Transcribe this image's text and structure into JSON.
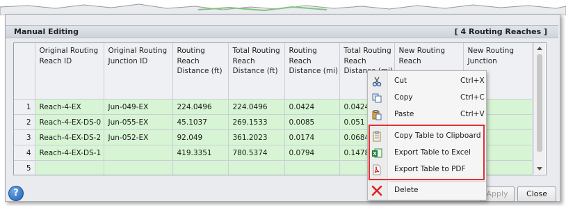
{
  "panel": {
    "title": "Manual Editing",
    "count_label": "[ 4 Routing Reaches ]"
  },
  "table": {
    "columns": [
      {
        "label": "Original Routing Reach ID"
      },
      {
        "label": "Original Routing Junction ID"
      },
      {
        "label": "Routing Reach Distance (ft)"
      },
      {
        "label": "Total Routing Reach Distance (ft)"
      },
      {
        "label": "Routing Reach Distance (mi)"
      },
      {
        "label": "Total Routing Reach Distance (mi)"
      },
      {
        "label": "New Routing Reach"
      },
      {
        "label": "New Routing Junction"
      }
    ],
    "rows": [
      {
        "n": "1",
        "c1": "Reach-4-EX",
        "c2": "Jun-049-EX",
        "c3": "224.0496",
        "c4": "224.0496",
        "c5": "0.0424",
        "c6": "0.0424"
      },
      {
        "n": "2",
        "c1": "Reach-4-EX-DS-0",
        "c2": "Jun-055-EX",
        "c3": "45.1037",
        "c4": "269.1533",
        "c5": "0.0085",
        "c6": "0.051"
      },
      {
        "n": "3",
        "c1": "Reach-4-EX-DS-2",
        "c2": "Jun-052-EX",
        "c3": "92.049",
        "c4": "361.2023",
        "c5": "0.0174",
        "c6": "0.0684"
      },
      {
        "n": "4",
        "c1": "Reach-4-EX-DS-1",
        "c2": "",
        "c3": "419.3351",
        "c4": "780.5374",
        "c5": "0.0794",
        "c6": "0.1478"
      },
      {
        "n": "5",
        "c1": "",
        "c2": "",
        "c3": "",
        "c4": "",
        "c5": "",
        "c6": ""
      }
    ]
  },
  "context_menu": {
    "cut": {
      "label": "Cut",
      "shortcut": "Ctrl+X"
    },
    "copy": {
      "label": "Copy",
      "shortcut": "Ctrl+C"
    },
    "paste": {
      "label": "Paste",
      "shortcut": "Ctrl+V"
    },
    "copy_table": {
      "label": "Copy Table to Clipboard"
    },
    "export_excel": {
      "label": "Export Table to Excel"
    },
    "export_pdf": {
      "label": "Export Table to PDF"
    },
    "delete": {
      "label": "Delete"
    }
  },
  "footer": {
    "help": "?",
    "apply": "Apply",
    "close": "Close"
  },
  "colors": {
    "row_fill": "#d7f5d4",
    "highlight": "#e03030"
  }
}
